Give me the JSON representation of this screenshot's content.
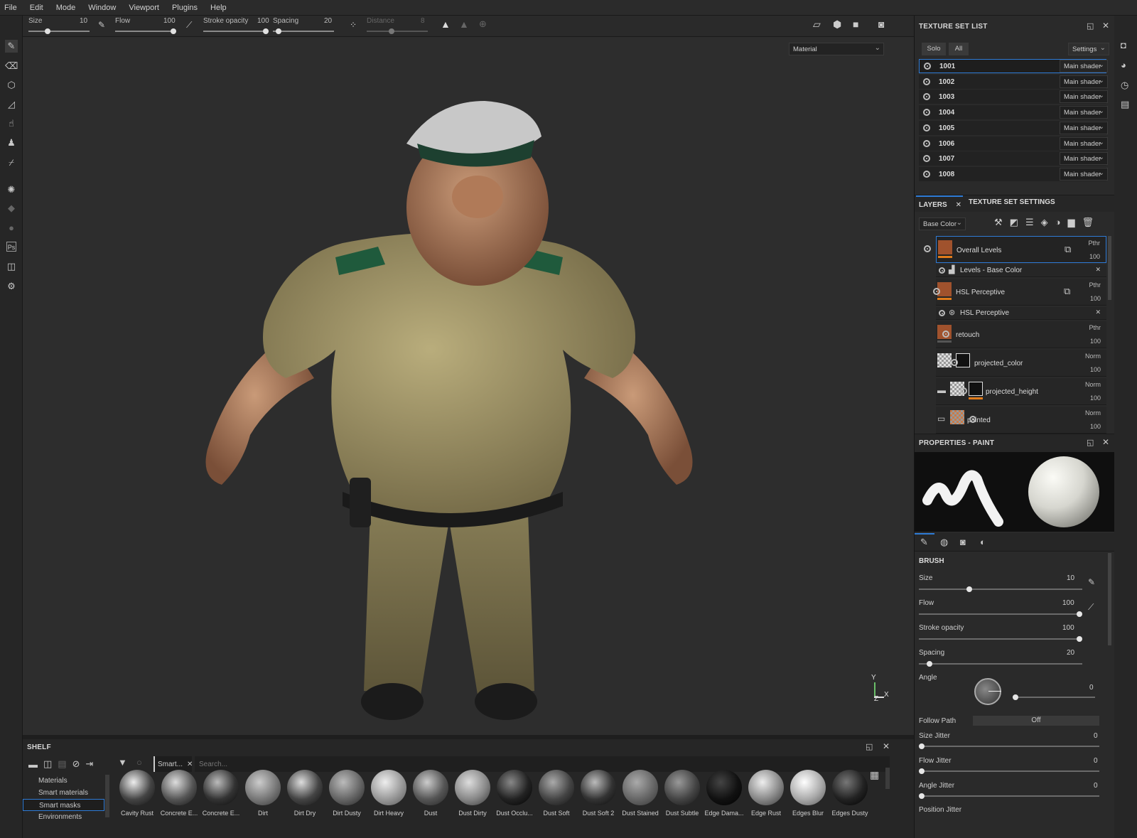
{
  "menu": [
    "File",
    "Edit",
    "Mode",
    "Window",
    "Viewport",
    "Plugins",
    "Help"
  ],
  "toolbar": {
    "size_label": "Size",
    "size_value": "10",
    "flow_label": "Flow",
    "flow_value": "100",
    "stroke_opacity_label": "Stroke opacity",
    "stroke_opacity_value": "100",
    "spacing_label": "Spacing",
    "spacing_value": "20",
    "distance_label": "Distance",
    "distance_value": "8",
    "slider_levels": {
      "size": 0.3,
      "flow": 1.0,
      "stroke_opacity": 1.0,
      "spacing": 0.05,
      "distance": 0.4
    }
  },
  "viewport": {
    "display_mode": "Material",
    "axis_labels": [
      "Y",
      "Z",
      "X"
    ]
  },
  "texture_set_list": {
    "title": "TEXTURE SET LIST",
    "solo_label": "Solo",
    "all_label": "All",
    "settings_label": "Settings",
    "sets": [
      {
        "name": "1001",
        "shader": "Main shader"
      },
      {
        "name": "1002",
        "shader": "Main shader"
      },
      {
        "name": "1003",
        "shader": "Main shader"
      },
      {
        "name": "1004",
        "shader": "Main shader"
      },
      {
        "name": "1005",
        "shader": "Main shader"
      },
      {
        "name": "1006",
        "shader": "Main shader"
      },
      {
        "name": "1007",
        "shader": "Main shader"
      },
      {
        "name": "1008",
        "shader": "Main shader"
      }
    ]
  },
  "layers_panel": {
    "tab_layers": "LAYERS",
    "tab_settings": "TEXTURE SET SETTINGS",
    "channel": "Base Color",
    "layers": [
      {
        "name": "Overall Levels",
        "blend": "Pthr",
        "opacity": "100"
      },
      {
        "name": "Levels - Base Color",
        "effect": true
      },
      {
        "name": "HSL Perceptive",
        "blend": "Pthr",
        "opacity": "100"
      },
      {
        "name": "HSL Perceptive",
        "effect": true
      },
      {
        "name": "retouch",
        "blend": "Pthr",
        "opacity": "100"
      },
      {
        "name": "projected_color",
        "blend": "Norm",
        "opacity": "100"
      },
      {
        "name": "projected_height",
        "blend": "Norm",
        "opacity": "100"
      },
      {
        "name": "painted",
        "blend": "Norm",
        "opacity": "100"
      }
    ]
  },
  "properties": {
    "title": "PROPERTIES - PAINT",
    "section": "BRUSH",
    "size_label": "Size",
    "size_value": "10",
    "flow_label": "Flow",
    "flow_value": "100",
    "stroke_opacity_label": "Stroke opacity",
    "stroke_opacity_value": "100",
    "spacing_label": "Spacing",
    "spacing_value": "20",
    "angle_label": "Angle",
    "angle_value": "0",
    "follow_path_label": "Follow Path",
    "follow_path_value": "Off",
    "size_jitter_label": "Size Jitter",
    "size_jitter_value": "0",
    "flow_jitter_label": "Flow Jitter",
    "flow_jitter_value": "0",
    "angle_jitter_label": "Angle Jitter",
    "angle_jitter_value": "0",
    "position_jitter_label": "Position Jitter",
    "slider_levels": {
      "size": 0.3,
      "flow": 1.0,
      "stroke_opacity": 1.0,
      "spacing": 0.05,
      "angle": 0.0,
      "size_jitter": 0.0,
      "flow_jitter": 0.0,
      "angle_jitter": 0.0
    }
  },
  "shelf": {
    "title": "SHELF",
    "tab_label": "Smart...",
    "search_placeholder": "Search...",
    "categories": [
      "Materials",
      "Smart materials",
      "Smart masks",
      "Environments"
    ],
    "selected_category": "Smart masks",
    "items": [
      "Cavity Rust",
      "Concrete E...",
      "Concrete E...",
      "Dirt",
      "Dirt Dry",
      "Dirt Dusty",
      "Dirt Heavy",
      "Dust",
      "Dust Dirty",
      "Dust Occlu...",
      "Dust Soft",
      "Dust Soft 2",
      "Dust Stained",
      "Dust Subtle",
      "Edge Dama...",
      "Edge Rust",
      "Edges Blur",
      "Edges Dusty"
    ]
  },
  "colors": {
    "accent": "#2e7bd6",
    "layer_thumb": "#a0522d",
    "viewport_bg": "#2d2d2d"
  }
}
